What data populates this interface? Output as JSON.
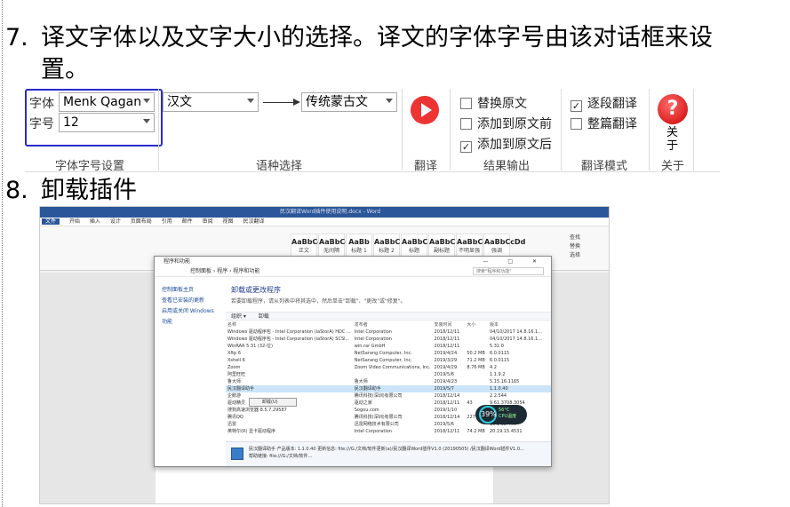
{
  "step7": {
    "num": "7.",
    "text_line1": "译文字体以及文字大小的选择。译文的字体字号由该对话框来设",
    "text_line2": "置。"
  },
  "ribbon": {
    "font_label": "字体",
    "font_value": "Menk Qagan",
    "size_label": "字号",
    "size_value": "12",
    "group_font": "字体字号设置",
    "source_lang": "汉文",
    "target_lang": "传统蒙古文",
    "group_lang": "语种选择",
    "group_translate": "翻译",
    "output_options": [
      {
        "label": "替换原文",
        "checked": false
      },
      {
        "label": "添加到原文前",
        "checked": false
      },
      {
        "label": "添加到原文后",
        "checked": true
      }
    ],
    "group_output": "结果输出",
    "mode_options": [
      {
        "label": "逐段翻译",
        "checked": true
      },
      {
        "label": "整篇翻译",
        "checked": false
      }
    ],
    "group_mode": "翻译模式",
    "about_label": "关于",
    "group_about": "关于",
    "check_mark": "✓",
    "colors": {
      "box_border": "#2a2ad0",
      "translate_red": "#e33333",
      "help_red": "#cc0000"
    }
  },
  "step8": {
    "num": "8.",
    "text": "卸载插件"
  },
  "word": {
    "title": "民汉翻译Word插件使用说明.docx - Word",
    "tabs": [
      "文件",
      "开始",
      "插入",
      "设计",
      "页面布局",
      "引用",
      "邮件",
      "审阅",
      "视图",
      "民汉翻译"
    ],
    "styles": [
      {
        "sample": "AaBbCcDd",
        "name": "正文"
      },
      {
        "sample": "AaBbCcDd",
        "name": "无间隔"
      },
      {
        "sample": "AaBb",
        "name": "标题 1"
      },
      {
        "sample": "AaBbC",
        "name": "标题 2"
      },
      {
        "sample": "AaBbC",
        "name": "标题"
      },
      {
        "sample": "AaBbC",
        "name": "副标题"
      },
      {
        "sample": "AaBbCcDd",
        "name": "不明显强调"
      },
      {
        "sample": "AaBbCcDd",
        "name": "强调"
      }
    ],
    "right_cmds": [
      "查找",
      "替换",
      "选择"
    ]
  },
  "dialog": {
    "title": "程序和功能",
    "window_controls": "— □ ✕",
    "breadcrumb": "控制面板 › 程序 › 程序和功能",
    "search_placeholder": "搜索\"程序和功能\"",
    "side_links": [
      "控制面板主页",
      "查看已安装的更新",
      "启用或关闭 Windows 功能"
    ],
    "heading": "卸载或更改程序",
    "subheading": "若要卸载程序，请从列表中将其选中，然后单击\"卸载\"、\"更改\"或\"修复\"。",
    "toolbar": [
      "组织 ▾",
      "卸载"
    ],
    "columns": [
      "名称",
      "发布者",
      "安装时间",
      "大小",
      "版本"
    ],
    "rows": [
      {
        "name": "Windows 驱动程序包 - Intel Corporation (iaStorA) HDC ...",
        "publisher": "Intel Corporation",
        "date": "2018/12/11",
        "size": "",
        "version": "04/10/2017 14.8.16.1..."
      },
      {
        "name": "Windows 驱动程序包 - Intel Corporation (iaStorA) SCSI...",
        "publisher": "Intel Corporation",
        "date": "2018/12/11",
        "size": "",
        "version": "04/10/2017 14.8.16.1..."
      },
      {
        "name": "WinRAR 5.31 (32-位)",
        "publisher": "win.rar GmbH",
        "date": "2018/12/11",
        "size": "",
        "version": "5.31.0"
      },
      {
        "name": "Xftp 6",
        "publisher": "NetSarang Computer, Inc.",
        "date": "2019/4/24",
        "size": "50.2 MB",
        "version": "6.0.0115"
      },
      {
        "name": "Xshell 6",
        "publisher": "NetSarang Computer, Inc.",
        "date": "2019/3/29",
        "size": "71.2 MB",
        "version": "6.0.0115"
      },
      {
        "name": "Zoom",
        "publisher": "Zoom Video Communications, Inc.",
        "date": "2019/4/29",
        "size": "8.76 MB",
        "version": "4.2"
      },
      {
        "name": "阿里旺旺",
        "publisher": "",
        "date": "2019/5/6",
        "size": "",
        "version": "1.1.9.2"
      },
      {
        "name": "鲁大师",
        "publisher": "鲁大师",
        "date": "2019/4/23",
        "size": "",
        "version": "5.15.16.1165"
      },
      {
        "name": "民汉翻译助手",
        "publisher": "民汉翻译助手",
        "date": "2019/5/7",
        "size": "",
        "version": "1.1.0.40",
        "selected": true
      },
      {
        "name": "企鹅游",
        "publisher": "腾讯科技(深圳)有限公司",
        "date": "2018/12/14",
        "size": "",
        "version": "2.2.544"
      },
      {
        "name": "驱动精灵",
        "publisher": "驱动之家",
        "date": "2018/12/11",
        "size": "43",
        "version": "9.61.3708.3054"
      },
      {
        "name": "搜狗高速浏览器 8.5.7.29587",
        "publisher": "Sogou.com",
        "date": "2019/1/10",
        "size": "",
        "version": "8.5.7.29587"
      },
      {
        "name": "腾讯QQ",
        "publisher": "腾讯科技(深圳)有限公司",
        "date": "2018/12/14",
        "size": "227 MB",
        "version": "9.0.8.24201"
      },
      {
        "name": "迅雷",
        "publisher": "迅雷网络技术有限公司",
        "date": "2019/5/6",
        "size": "",
        "version": "10.1.12.400"
      },
      {
        "name": "英特尔(R) 显卡驱动程序",
        "publisher": "Intel Corporation",
        "date": "2018/12/11",
        "size": "74.2 MB",
        "version": "20.19.15.4531"
      }
    ],
    "context_menu": "卸载(U)",
    "status": {
      "line1": "民汉翻译助手  产品版本: 1.1.0.40      更新信息: file:///G:/文档/软件更新(a)/民汉翻译Word插件V1.0 (20190505) /民汉翻译Word插件V1.0...",
      "line2": "帮助链接: file:///G:/文档/软件..."
    }
  },
  "cpu_widget": {
    "percent": "39%",
    "temp": "56°C",
    "label": "CPU温度"
  }
}
